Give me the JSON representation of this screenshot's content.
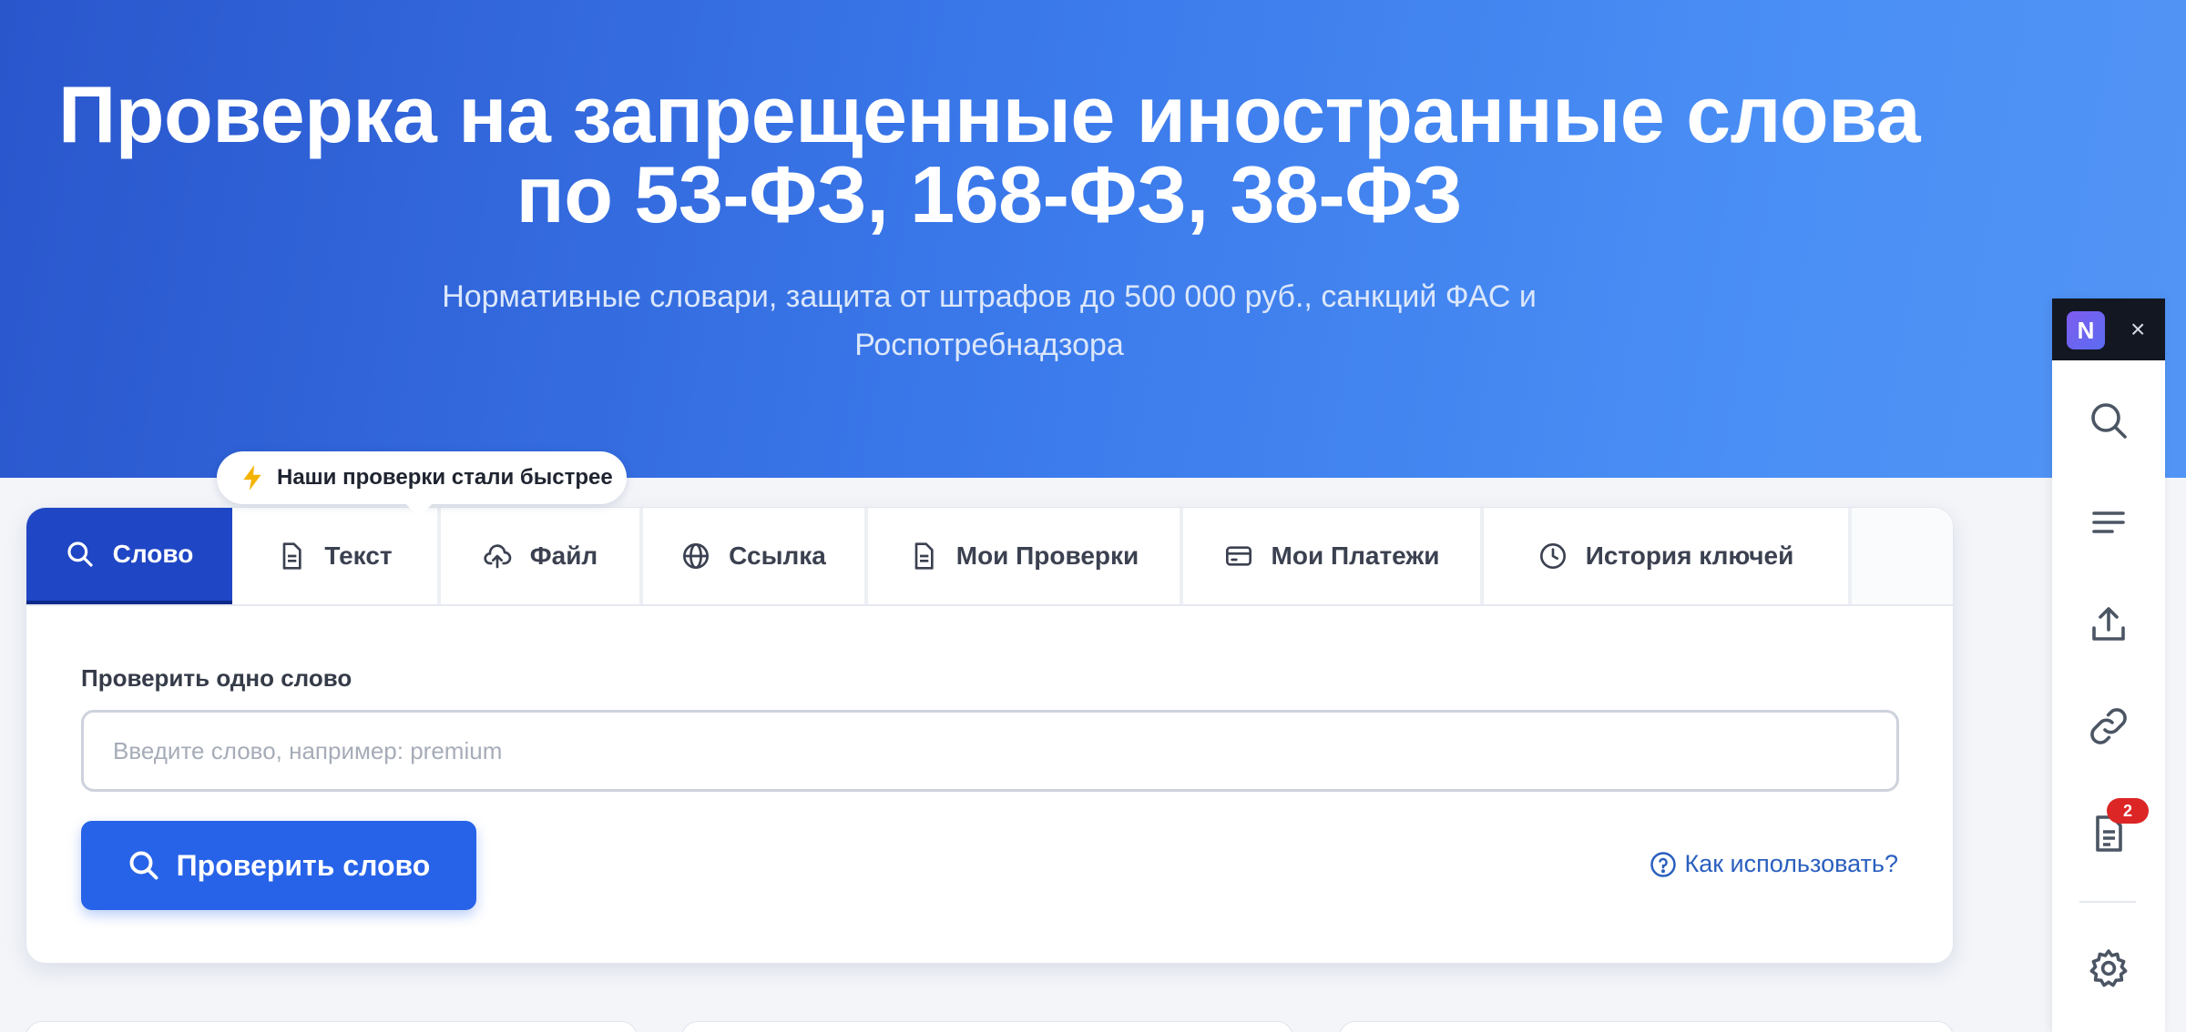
{
  "hero": {
    "title_line1": "Проверка на запрещенные иностранные слова",
    "title_line2": "по 53-ФЗ, 168-ФЗ, 38-ФЗ",
    "subtitle_line1": "Нормативные словари, защита от штрафов до 500 000 руб., санкций ФАС и",
    "subtitle_line2": "Роспотребнадзора"
  },
  "tooltip": {
    "text": "Наши проверки стали быстрее",
    "icon": "bolt-icon"
  },
  "tabs": [
    {
      "label": "Слово",
      "icon": "search-icon",
      "active": true
    },
    {
      "label": "Текст",
      "icon": "document-icon",
      "active": false
    },
    {
      "label": "Файл",
      "icon": "cloud-upload-icon",
      "active": false
    },
    {
      "label": "Ссылка",
      "icon": "globe-icon",
      "active": false
    },
    {
      "label": "Мои Проверки",
      "icon": "document-icon",
      "active": false
    },
    {
      "label": "Мои Платежи",
      "icon": "credit-card-icon",
      "active": false
    },
    {
      "label": "История ключей",
      "icon": "clock-icon",
      "active": false
    }
  ],
  "form": {
    "label": "Проверить одно слово",
    "input_value": "",
    "input_placeholder": "Введите слово, например: premium",
    "submit_label": "Проверить слово",
    "help_label": "Как использовать?"
  },
  "extension": {
    "logo_letter": "N",
    "close_glyph": "×",
    "icons": [
      "search-icon",
      "menu-lines-icon",
      "upload-icon",
      "link-icon",
      "document-icon",
      "settings-icon"
    ],
    "badge_count": "2"
  },
  "colors": {
    "accent": "#2763e8",
    "active_tab": "#1f46c4",
    "badge": "#dc2626",
    "tooltip_bolt": "#f5b301"
  }
}
